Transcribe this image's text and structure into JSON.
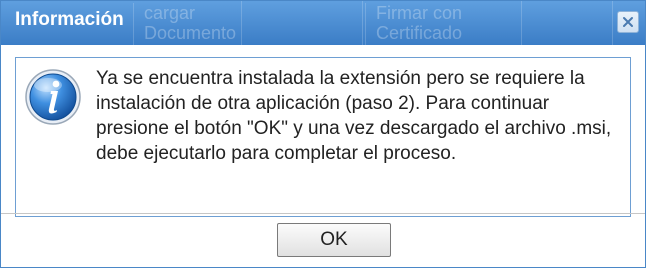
{
  "dialog": {
    "title": "Información",
    "message": "Ya se encuentra instalada la extensión pero se requiere la instalación de otra aplicación (paso 2). Para continuar presione el botón \"OK\" y una vez descargado el archivo .msi, debe ejecutarlo para completar el proceso.",
    "ok_label": "OK",
    "icon": "info-icon",
    "close_icon": "close-icon"
  },
  "background_ribbon": {
    "item1": "cargar Documento",
    "item2": "Firmar con Certificado"
  },
  "colors": {
    "titlebar": "#3b7dc6",
    "border": "#4a87c7",
    "text": "#222222"
  }
}
